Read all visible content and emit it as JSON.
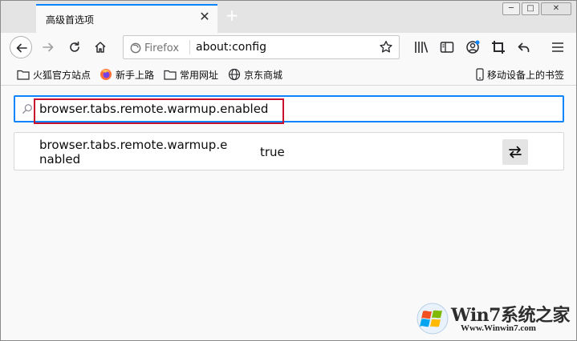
{
  "tab": {
    "title": "高级首选项",
    "close_glyph": "✕",
    "new_tab_glyph": "+"
  },
  "window": {
    "minimize_glyph": "─",
    "maximize_glyph": "□",
    "close_glyph": "✕"
  },
  "urlbar": {
    "identity_label": "Firefox",
    "url": "about:config"
  },
  "bookmarks": [
    {
      "label": "火狐官方站点",
      "icon": "folder-icon"
    },
    {
      "label": "新手上路",
      "icon": "firefox-icon"
    },
    {
      "label": "常用网址",
      "icon": "folder-icon"
    },
    {
      "label": "京东商城",
      "icon": "globe-icon"
    },
    {
      "label": "移动设备上的书签",
      "icon": "mobile-icon"
    }
  ],
  "search": {
    "value": "browser.tabs.remote.warmup.enabled"
  },
  "preference": {
    "name": "browser.tabs.remote.warmup.enabled",
    "value": "true"
  },
  "watermark": {
    "title": "Win7系统之家",
    "url": "Www.Winwin7.com"
  },
  "colors": {
    "accent": "#0a84ff",
    "highlight": "#c8102e",
    "tabstrip": "#e4e4e5"
  }
}
